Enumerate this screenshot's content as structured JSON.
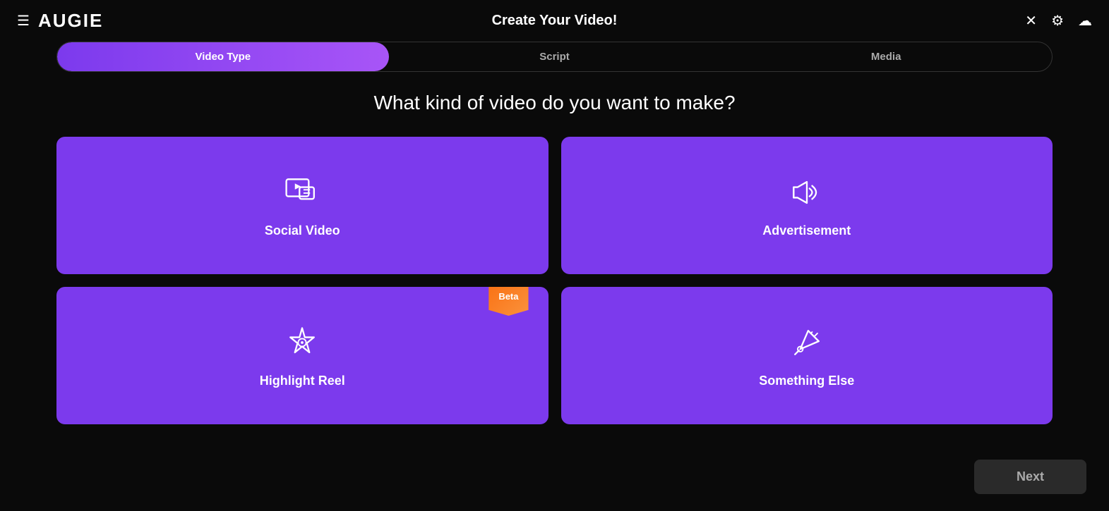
{
  "app": {
    "logo": "AUGiE",
    "title": "Create Your Video!"
  },
  "header": {
    "hamburger_label": "☰",
    "close_label": "✕",
    "settings_label": "⚙",
    "upload_label": "☁"
  },
  "tabs": [
    {
      "id": "video-type",
      "label": "Video Type",
      "active": true
    },
    {
      "id": "script",
      "label": "Script",
      "active": false
    },
    {
      "id": "media",
      "label": "Media",
      "active": false
    }
  ],
  "question": "What kind of video do you want to make?",
  "video_types": [
    {
      "id": "social-video",
      "label": "Social Video",
      "icon": "social",
      "beta": false
    },
    {
      "id": "advertisement",
      "label": "Advertisement",
      "icon": "advertisement",
      "beta": false
    },
    {
      "id": "highlight-reel",
      "label": "Highlight Reel",
      "icon": "highlight",
      "beta": true,
      "beta_label": "Beta"
    },
    {
      "id": "something-else",
      "label": "Something Else",
      "icon": "rocket",
      "beta": false
    }
  ],
  "buttons": {
    "next": "Next"
  },
  "colors": {
    "purple_primary": "#7c3aed",
    "purple_light": "#a855f7",
    "orange_beta": "#f97316",
    "bg": "#0a0a0a",
    "card_bg": "#7c3aed",
    "next_bg": "#2a2a2a",
    "next_color": "#aaa"
  }
}
